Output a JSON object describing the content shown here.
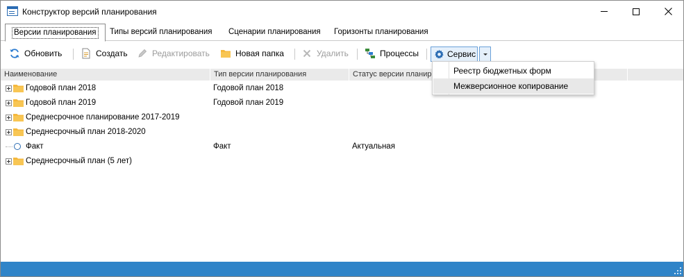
{
  "window": {
    "title": "Конструктор версий планирования"
  },
  "tabs": [
    {
      "label": "Версии планирования",
      "active": true
    },
    {
      "label": "Типы версий планирования",
      "active": false
    },
    {
      "label": "Сценарии планирования",
      "active": false
    },
    {
      "label": "Горизонты планирования",
      "active": false
    }
  ],
  "toolbar": {
    "refresh_label": "Обновить",
    "create_label": "Создать",
    "edit_label": "Редактировать",
    "new_folder_label": "Новая папка",
    "delete_label": "Удалить",
    "processes_label": "Процессы",
    "service_label": "Сервис"
  },
  "grid": {
    "columns": [
      "Наименование",
      "Тип версии планирования",
      "Статус версии планир"
    ],
    "rows": [
      {
        "name": "Годовой план 2018",
        "type": "Годовой план 2018",
        "status": "",
        "kind": "folder"
      },
      {
        "name": "Годовой план 2019",
        "type": "Годовой план 2019",
        "status": "",
        "kind": "folder"
      },
      {
        "name": "Среднесрочное планирование 2017-2019",
        "type": "",
        "status": "",
        "kind": "folder"
      },
      {
        "name": "Среднесрочный план 2018-2020",
        "type": "",
        "status": "",
        "kind": "folder"
      },
      {
        "name": "Факт",
        "type": "Факт",
        "status": "Актуальная",
        "kind": "version"
      },
      {
        "name": "Среднесрочный план (5 лет)",
        "type": "",
        "status": "",
        "kind": "folder"
      }
    ]
  },
  "service_menu": {
    "items": [
      {
        "label": "Реестр бюджетных форм",
        "highlighted": false
      },
      {
        "label": "Межверсионное копирование",
        "highlighted": true
      }
    ]
  },
  "colors": {
    "accent": "#2f84c8",
    "folder": "#f5b83d",
    "header_bg": "#eaeaea"
  }
}
